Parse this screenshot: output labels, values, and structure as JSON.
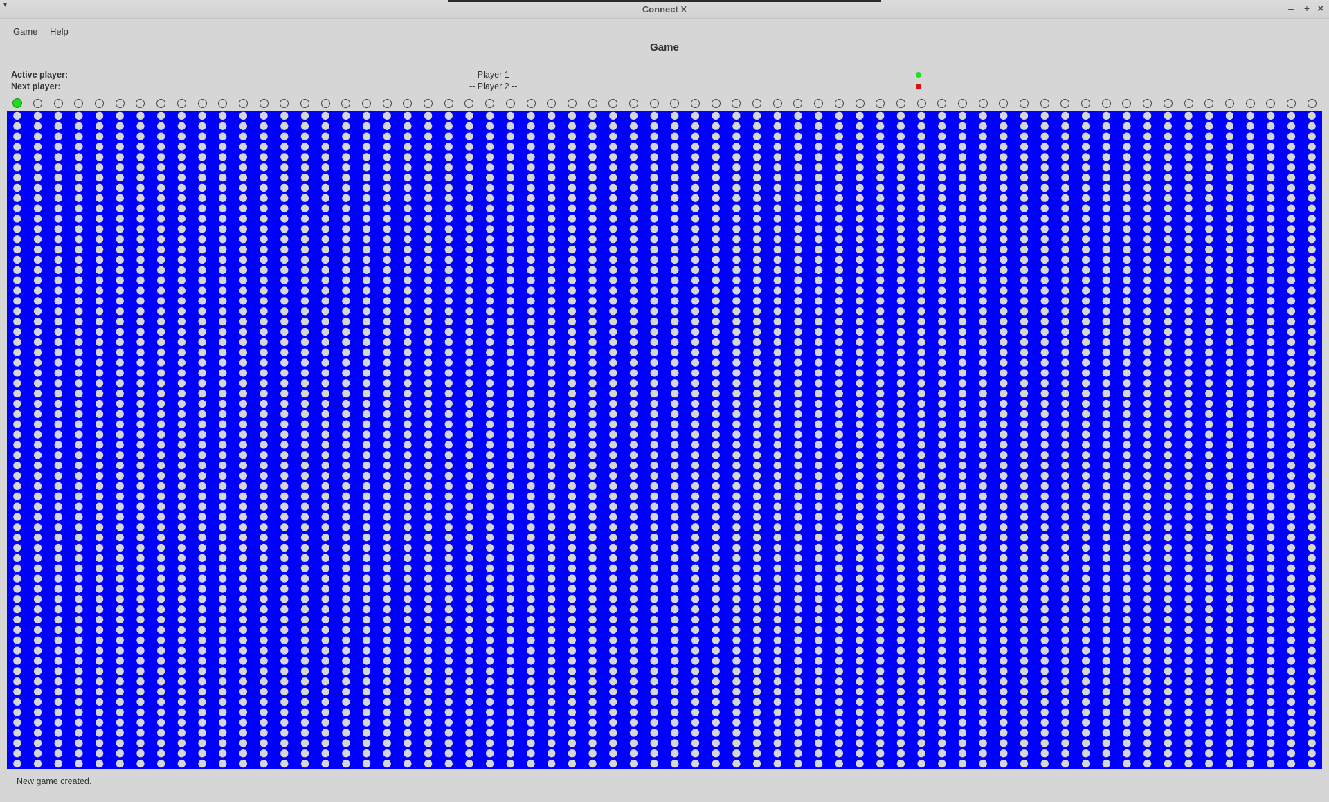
{
  "window": {
    "title": "Connect X",
    "menu_glyph": "▾",
    "controls": {
      "minimize": "–",
      "maximize": "+",
      "close": "✕"
    }
  },
  "menubar": {
    "items": [
      "Game",
      "Help"
    ]
  },
  "page": {
    "title": "Game"
  },
  "players": {
    "active": {
      "label": "Active player:",
      "name": "-- Player 1 --",
      "color": "#22dd22"
    },
    "next": {
      "label": "Next player:",
      "name": "-- Player 2 --",
      "color": "#dd1111"
    }
  },
  "board": {
    "columns": 64,
    "rows": 64,
    "selected_column": 0,
    "board_color": "#0000ff",
    "empty_cell_color": "#d6d6d6"
  },
  "status": {
    "message": "New game created."
  }
}
